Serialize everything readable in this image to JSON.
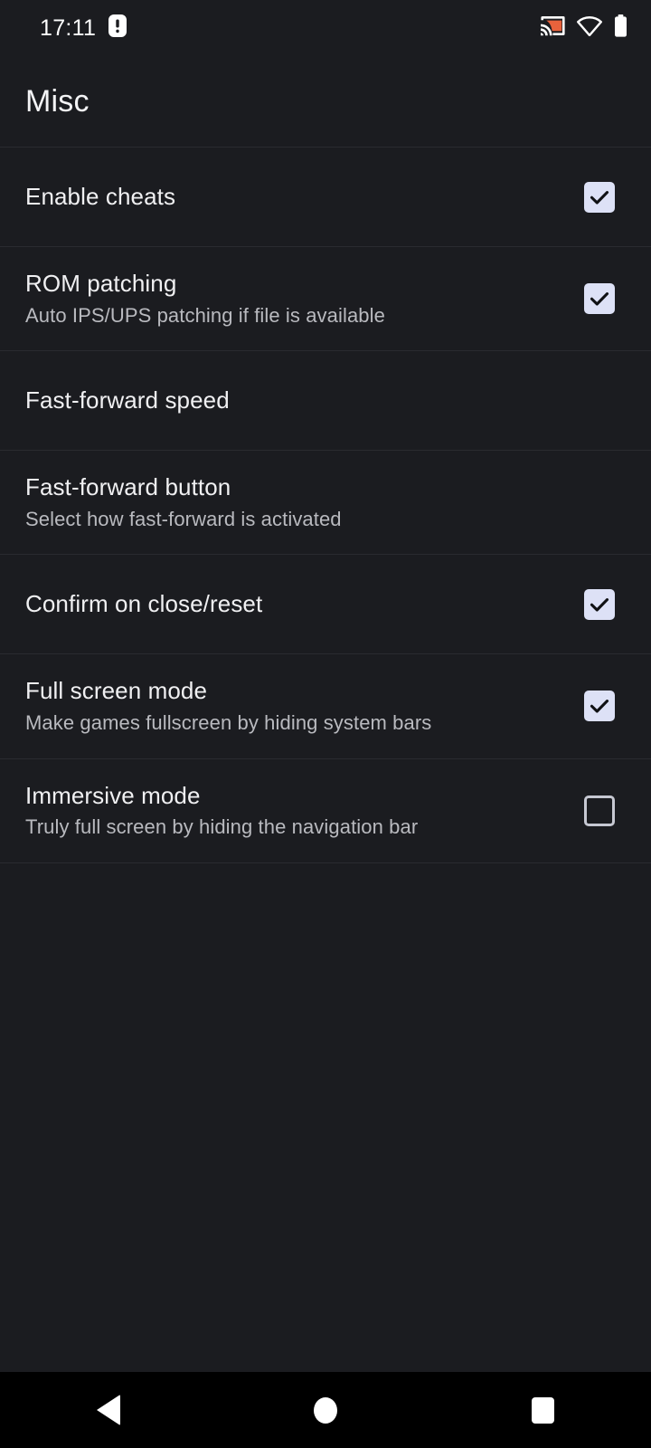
{
  "status_bar": {
    "time": "17:11",
    "notification_icons": [
      "sdcard-alert-icon"
    ],
    "system_icons": [
      "cast-icon",
      "wifi-icon",
      "battery-icon"
    ],
    "cast_accent_color": "#E8623C",
    "icon_color": "#FFFFFF"
  },
  "header": {
    "title": "Misc"
  },
  "theme": {
    "background": "#1b1c20",
    "divider": "#2a2b30",
    "title_text": "#f0f0f2",
    "summary_text": "#b9babf",
    "checkbox_checked_fill": "#dde1f6",
    "checkbox_check_mark": "#101114",
    "checkbox_unchecked_border": "#c6c8d2",
    "nav_bar_background": "#000000"
  },
  "preferences": [
    {
      "title": "Enable cheats",
      "summary": "",
      "control": "checkbox",
      "checked": true
    },
    {
      "title": "ROM patching",
      "summary": "Auto IPS/UPS patching if file is available",
      "control": "checkbox",
      "checked": true
    },
    {
      "title": "Fast-forward speed",
      "summary": "",
      "control": "none",
      "checked": false
    },
    {
      "title": "Fast-forward button",
      "summary": "Select how fast-forward is activated",
      "control": "none",
      "checked": false
    },
    {
      "title": "Confirm on close/reset",
      "summary": "",
      "control": "checkbox",
      "checked": true
    },
    {
      "title": "Full screen mode",
      "summary": "Make games fullscreen by hiding system bars",
      "control": "checkbox",
      "checked": true
    },
    {
      "title": "Immersive mode",
      "summary": "Truly full screen by hiding the navigation bar",
      "control": "checkbox",
      "checked": false
    }
  ],
  "navigation_bar": {
    "buttons": [
      {
        "name": "back",
        "icon": "triangle-left-icon"
      },
      {
        "name": "home",
        "icon": "circle-icon"
      },
      {
        "name": "recents",
        "icon": "square-icon"
      }
    ]
  }
}
